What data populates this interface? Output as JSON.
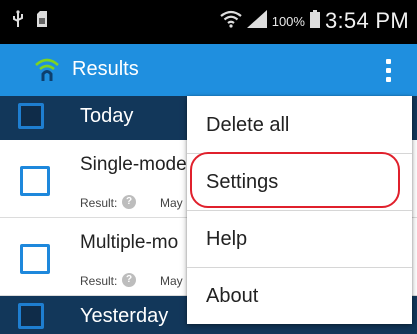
{
  "status_bar": {
    "battery_percent": "100%",
    "time": "3:54 PM",
    "icons": [
      "usb-icon",
      "sd-card-icon",
      "wifi-icon",
      "signal-icon",
      "battery-icon"
    ]
  },
  "action_bar": {
    "title": "Results",
    "color": "#1f8fdf",
    "icons": [
      "app-wifi-icon",
      "overflow-menu-icon"
    ]
  },
  "sections": [
    {
      "header": "Today",
      "items": [
        {
          "title": "Single-mode",
          "result_label": "Result:",
          "date": "May"
        },
        {
          "title": "Multiple-mo",
          "result_label": "Result:",
          "date": "May"
        }
      ]
    },
    {
      "header": "Yesterday",
      "items": []
    }
  ],
  "menu": {
    "items": [
      "Delete all",
      "Settings",
      "Help",
      "About"
    ],
    "highlighted": "Settings",
    "highlight_color": "#e0202c"
  }
}
